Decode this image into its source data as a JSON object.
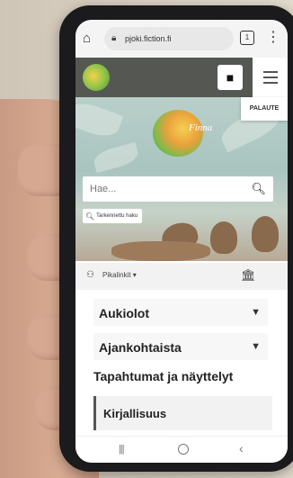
{
  "browser": {
    "url": "pjoki.fiction.fi",
    "tab_count": "1"
  },
  "header": {
    "feedback_label": "PALAUTE"
  },
  "hero": {
    "logo_text": "Finna",
    "search_placeholder": "Hae...",
    "advanced_search_label": "Tarkennettu haku"
  },
  "quick_links": {
    "label": "Pikalinkit"
  },
  "accordions": [
    {
      "label": "Aukiolot"
    },
    {
      "label": "Ajankohtaista"
    }
  ],
  "section": {
    "title": "Tapahtumat ja näyttelyt",
    "item": "Kirjallisuus"
  }
}
